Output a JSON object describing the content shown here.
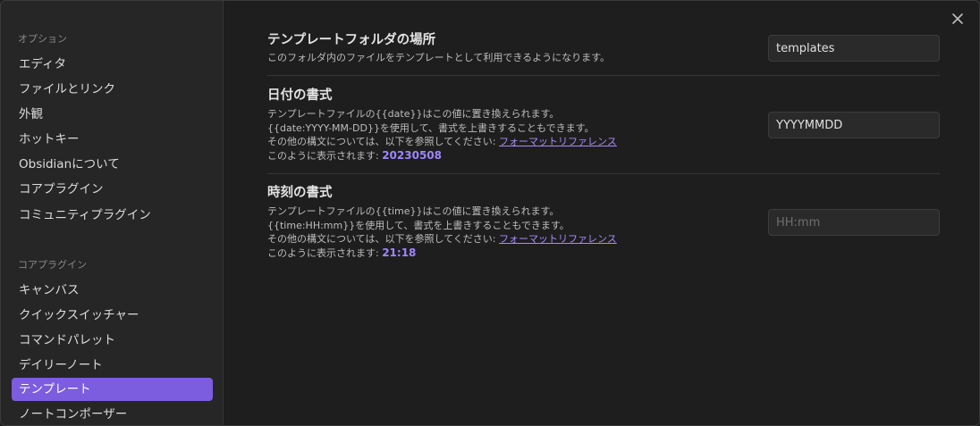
{
  "sidebar": {
    "options_heading": "オプション",
    "options_items": [
      {
        "label": "エディタ"
      },
      {
        "label": "ファイルとリンク"
      },
      {
        "label": "外観"
      },
      {
        "label": "ホットキー"
      },
      {
        "label": "Obsidianについて"
      },
      {
        "label": "コアプラグイン"
      },
      {
        "label": "コミュニティプラグイン"
      }
    ],
    "core_heading": "コアプラグイン",
    "core_items": [
      {
        "label": "キャンバス"
      },
      {
        "label": "クイックスイッチャー"
      },
      {
        "label": "コマンドパレット"
      },
      {
        "label": "デイリーノート"
      },
      {
        "label": "テンプレート",
        "active": true
      },
      {
        "label": "ノートコンポーザー"
      }
    ]
  },
  "settings": {
    "folder": {
      "title": "テンプレートフォルダの場所",
      "desc": "このフォルダ内のファイルをテンプレートとして利用できるようになります。",
      "value": "templates"
    },
    "date": {
      "title": "日付の書式",
      "desc_line1": "テンプレートファイルの{{date}}はこの値に置き換えられます。",
      "desc_line2": "{{date:YYYY-MM-DD}}を使用して、書式を上書きすることもできます。",
      "desc_line3": "その他の構文については、以下を参照してください: ",
      "link": "フォーマットリファレンス",
      "preview_label": "このように表示されます: ",
      "preview_value": "20230508",
      "value": "YYYYMMDD"
    },
    "time": {
      "title": "時刻の書式",
      "desc_line1": "テンプレートファイルの{{time}}はこの値に置き換えられます。",
      "desc_line2": "{{time:HH:mm}}を使用して、書式を上書きすることもできます。",
      "desc_line3": "その他の構文については、以下を参照してください: ",
      "link": "フォーマットリファレンス",
      "preview_label": "このように表示されます: ",
      "preview_value": "21:18",
      "placeholder": "HH:mm"
    }
  },
  "colors": {
    "accent": "#7c5cdf",
    "link": "#a88bfa",
    "background": "#1e1e1e",
    "sidebar": "#262626"
  },
  "icons": {
    "close": "close-icon"
  }
}
